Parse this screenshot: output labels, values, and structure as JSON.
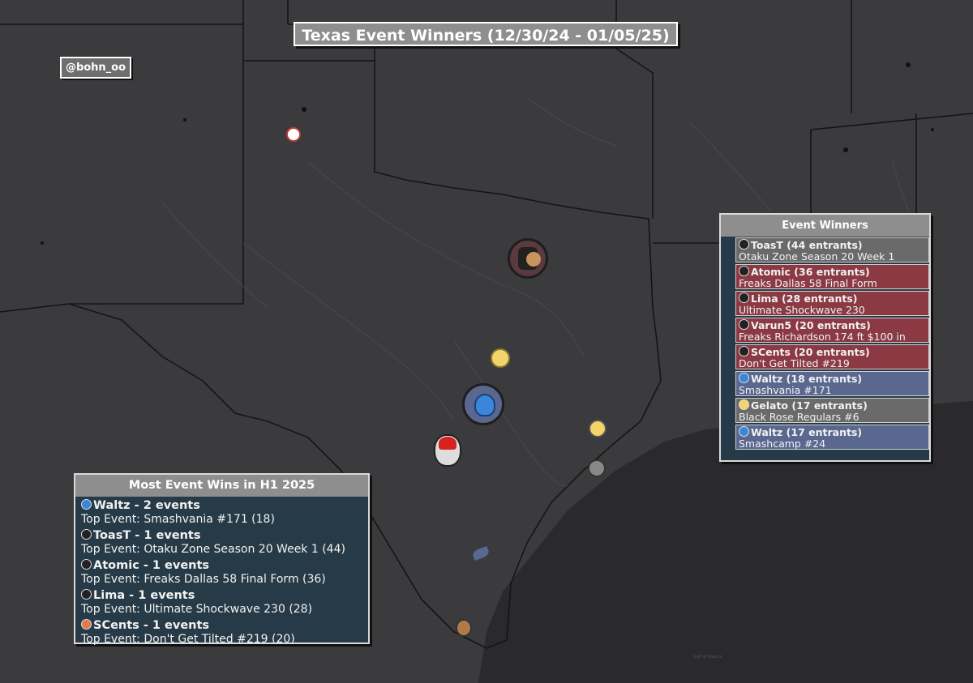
{
  "title": "Texas Event Winners (12/30/24 - 01/05/25)",
  "credit": "@bohn_oo",
  "colors": {
    "map_land": "#3b3b3e",
    "map_water": "#2b2b2e",
    "panel_bg": "#263b47",
    "panel_header": "#8e8e8e",
    "row_red": "#8b3a44",
    "row_grey": "#6a6a6a",
    "row_blue": "#5a6890"
  },
  "map": {
    "labels": [
      "Gulf of Mexico"
    ]
  },
  "event_winners": {
    "header": "Event Winners",
    "rows": [
      {
        "player": "ToasT (44 entrants)",
        "event": "Otaku Zone Season 20 Week 1",
        "color": "#6a6a6a",
        "icon": "black-hair-character-icon"
      },
      {
        "player": "Atomic (36 entrants)",
        "event": "Freaks Dallas 58 Final Form",
        "color": "#8b3a44",
        "icon": "cap-character-icon"
      },
      {
        "player": "Lima (28 entrants)",
        "event": "Ultimate Shockwave 230",
        "color": "#8b3a44",
        "icon": "dark-hair-character-icon"
      },
      {
        "player": "Varun5 (20 entrants)",
        "event": "Freaks Richardson 174 ft $100 in",
        "color": "#8b3a44",
        "icon": "brown-hair-character-icon"
      },
      {
        "player": "SCents (20 entrants)",
        "event": "Don't Get Tilted #219",
        "color": "#8b3a44",
        "icon": "orange-character-icon"
      },
      {
        "player": "Waltz (18 entrants)",
        "event": "Smashvania #171",
        "color": "#5a6890",
        "icon": "blue-robot-character-icon"
      },
      {
        "player": "Gelato (17 entrants)",
        "event": "Black Rose Regulars #6",
        "color": "#6a6a6a",
        "icon": "blonde-character-icon"
      },
      {
        "player": "Waltz (17 entrants)",
        "event": "Smashcamp #24",
        "color": "#5a6890",
        "icon": "blue-robot-character-icon"
      }
    ]
  },
  "most_wins": {
    "header": "Most Event Wins in H1 2025",
    "items": [
      {
        "player": "Waltz - 2 events",
        "top": "Top Event: Smashvania #171 (18)",
        "icon": "blue-robot-character-icon"
      },
      {
        "player": "ToasT - 1 events",
        "top": "Top Event: Otaku Zone Season 20 Week 1 (44)",
        "icon": "black-hair-character-icon"
      },
      {
        "player": "Atomic - 1 events",
        "top": "Top Event: Freaks Dallas 58 Final Form (36)",
        "icon": "cap-character-icon"
      },
      {
        "player": "Lima - 1 events",
        "top": "Top Event: Ultimate Shockwave 230 (28)",
        "icon": "dark-hair-character-icon"
      },
      {
        "player": "SCents - 1 events",
        "top": "Top Event: Don't Get Tilted #219 (20)",
        "icon": "orange-character-icon"
      }
    ]
  },
  "markers": [
    {
      "name": "lubbock-marker",
      "icon": "red-hair-character-icon",
      "color": "#c23b3b"
    },
    {
      "name": "dfw-marker",
      "icon": "character-group-icon",
      "color": "#8b3a44"
    },
    {
      "name": "waco-marker",
      "icon": "blonde-character-icon",
      "color": "#d6b64a"
    },
    {
      "name": "austin-marker",
      "icon": "blue-robot-character-icon",
      "color": "#5a6890"
    },
    {
      "name": "san-antonio-marker",
      "icon": "red-hair-character-icon",
      "color": "#c23b3b"
    },
    {
      "name": "houston-north-marker",
      "icon": "blonde-character-icon",
      "color": "#d6b64a"
    },
    {
      "name": "houston-marker",
      "icon": "grey-character-icon",
      "color": "#8a8a8a"
    },
    {
      "name": "corpus-marker",
      "icon": "bird-icon",
      "color": "#5a6890"
    },
    {
      "name": "valley-marker",
      "icon": "brown-hair-character-icon",
      "color": "#a0643c"
    }
  ]
}
